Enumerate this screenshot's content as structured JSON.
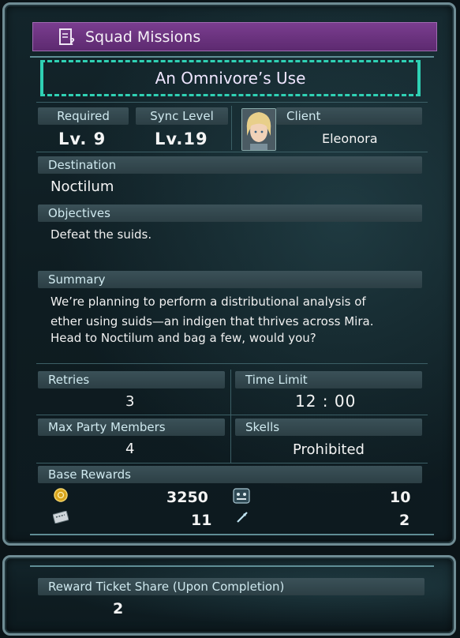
{
  "header": {
    "title": "Squad Missions",
    "icon": "mission-document-icon"
  },
  "mission": {
    "name": "An Omnivore’s Use"
  },
  "requirements": {
    "required_label": "Required",
    "required_value": "Lv.  9",
    "sync_label": "Sync Level",
    "sync_value": "Lv.19",
    "client_label": "Client",
    "client_name": "Eleonora"
  },
  "destination": {
    "label": "Destination",
    "value": "Noctilum"
  },
  "objectives": {
    "label": "Objectives",
    "value": "Defeat the suids."
  },
  "summary": {
    "label": "Summary",
    "lines": [
      "We’re planning to perform a distributional analysis of",
      "ether using suids—an indigen that thrives across Mira.",
      "Head to Noctilum and bag a few, would you?"
    ]
  },
  "stats": {
    "retries_label": "Retries",
    "retries_value": "3",
    "time_limit_label": "Time Limit",
    "time_limit_value": "12 : 00",
    "max_party_label": "Max Party Members",
    "max_party_value": "4",
    "skells_label": "Skells",
    "skells_value": "Prohibited"
  },
  "rewards": {
    "label": "Base Rewards",
    "items": [
      {
        "icon": "credits-coin-icon",
        "value": "3250"
      },
      {
        "icon": "experience-icon",
        "value": "10"
      },
      {
        "icon": "reward-ticket-icon",
        "value": "11"
      },
      {
        "icon": "battle-points-icon",
        "value": "2"
      }
    ]
  },
  "ticket_share": {
    "label": "Reward Ticket Share (Upon Completion)",
    "value": "2"
  },
  "colors": {
    "accent_purple": "#6b3380",
    "accent_teal": "#2fd1b4",
    "label_bar": "#34494f"
  }
}
